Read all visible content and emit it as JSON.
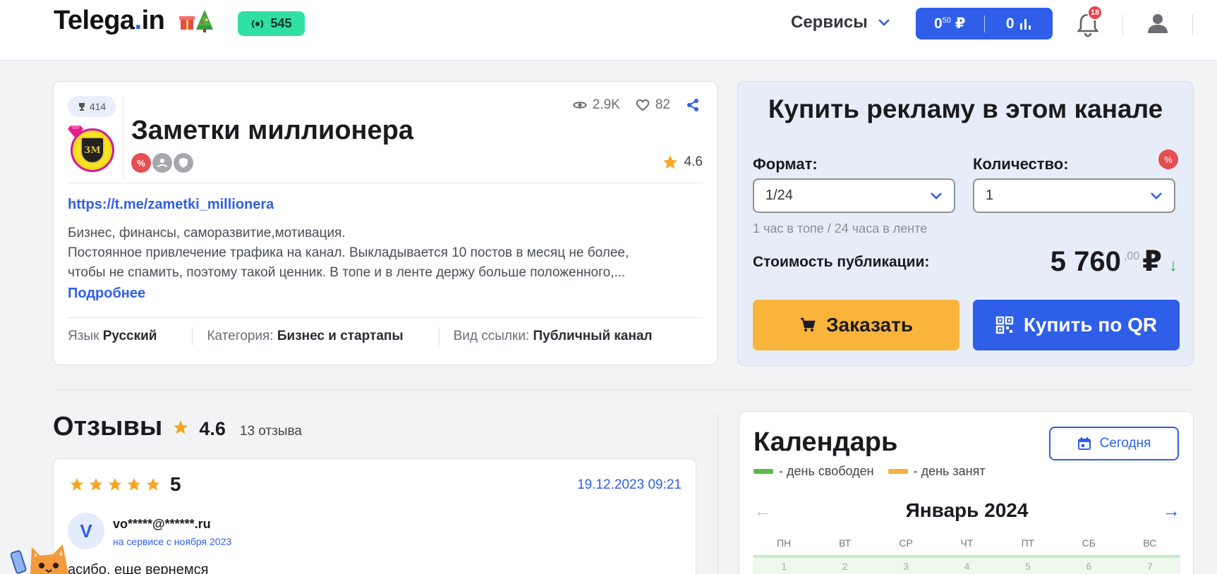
{
  "header": {
    "logo_text": "Telega",
    "logo_dot": ".",
    "logo_tld": "in",
    "online_count": "545",
    "services_label": "Сервисы",
    "balance_main": "0",
    "balance_cents": "50",
    "balance_currency": "₽",
    "balance_second": "0",
    "notifications_count": "18"
  },
  "channel": {
    "rank": "414",
    "avatar_text": "3M",
    "title": "Заметки миллионера",
    "views": "2.9K",
    "likes": "82",
    "rating": "4.6",
    "link": "https://t.me/zametki_millionera",
    "description_1": "Бизнес, финансы, саморазвитие,мотивация.",
    "description_2": "Постоянное привлечение трафика на канал. Выкладывается 10 постов в месяц не более,",
    "description_3": "чтобы не спамить, поэтому такой ценник. В топе и в ленте держу больше положенного,...",
    "more_label": "Подробнее",
    "language_label": "Язык",
    "language_value": "Русский",
    "category_label": "Категория:",
    "category_value": "Бизнес и стартапы",
    "link_type_label": "Вид ссылки:",
    "link_type_value": "Публичный канал"
  },
  "buy": {
    "title": "Купить рекламу в этом канале",
    "format_label": "Формат:",
    "format_value": "1/24",
    "quantity_label": "Количество:",
    "quantity_value": "1",
    "percent_badge": "%",
    "hint": "1 час в топе / 24 часа в ленте",
    "cost_label": "Стоимость публикации:",
    "cost_value": "5 760",
    "cost_cents": ",00",
    "cost_currency": "₽",
    "order_label": "Заказать",
    "qr_label": "Купить по QR"
  },
  "reviews": {
    "title": "Отзывы",
    "rating": "4.6",
    "count": "13 отзыва",
    "items": [
      {
        "score": "5",
        "stars": 5,
        "date": "19.12.2023 09:21",
        "avatar_letter": "V",
        "user": "vo*****@******.ru",
        "since": "на сервисе с ноября 2023",
        "text": "асибо, еще вернемся"
      }
    ]
  },
  "calendar": {
    "title": "Календарь",
    "today_label": "Сегодня",
    "legend_free": "- день свободен",
    "legend_busy": "- день занят",
    "month": "Январь 2024",
    "weekdays": [
      "ПН",
      "ВТ",
      "СР",
      "ЧТ",
      "ПТ",
      "СБ",
      "ВС"
    ],
    "days": [
      "1",
      "2",
      "3",
      "4",
      "5",
      "6",
      "7"
    ]
  },
  "colors": {
    "accent": "#2f5ee8",
    "online_green": "#2fe0a2",
    "order_yellow": "#f9b43c",
    "free_green": "#5db94f",
    "busy_orange": "#f3b23f",
    "star": "#f6a623"
  }
}
